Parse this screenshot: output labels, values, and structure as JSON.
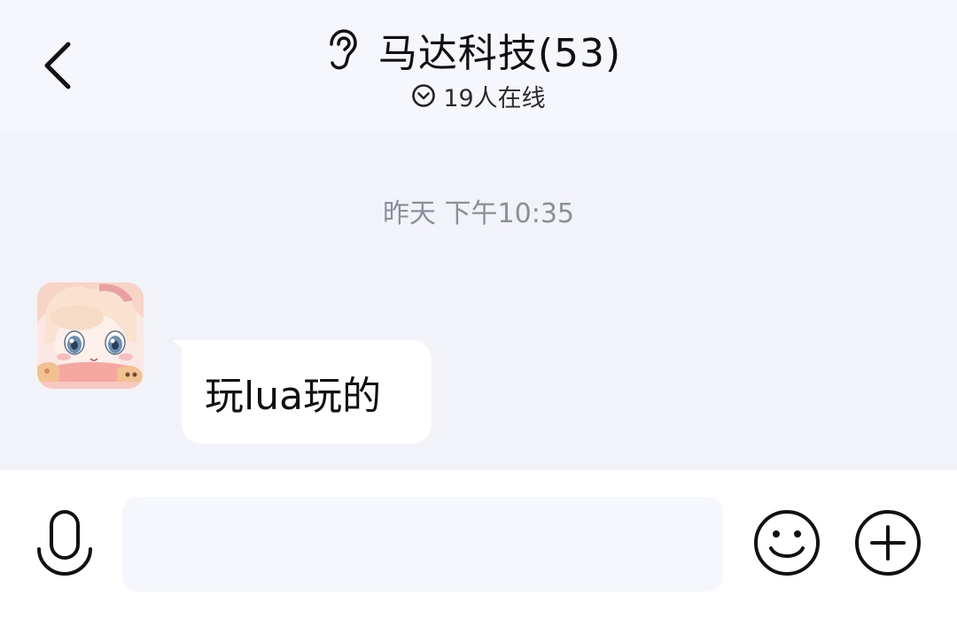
{
  "header": {
    "title": "马达科技(53)",
    "online_text": "19人在线"
  },
  "chat": {
    "timestamp": "昨天 下午10:35",
    "messages": [
      {
        "text": "玩lua玩的"
      }
    ]
  },
  "input": {
    "value": "",
    "placeholder": ""
  },
  "icons": {
    "back": "chevron-left-icon",
    "ear": "ear-icon",
    "online": "chevron-down-circle-icon",
    "voice": "microphone-icon",
    "emoji": "smiley-icon",
    "plus": "plus-circle-icon"
  },
  "colors": {
    "header_bg": "#f6f7fd",
    "chat_bg": "#f2f3f8",
    "bubble_bg": "#ffffff",
    "timestamp": "#8b8f9c",
    "text": "#111111"
  }
}
